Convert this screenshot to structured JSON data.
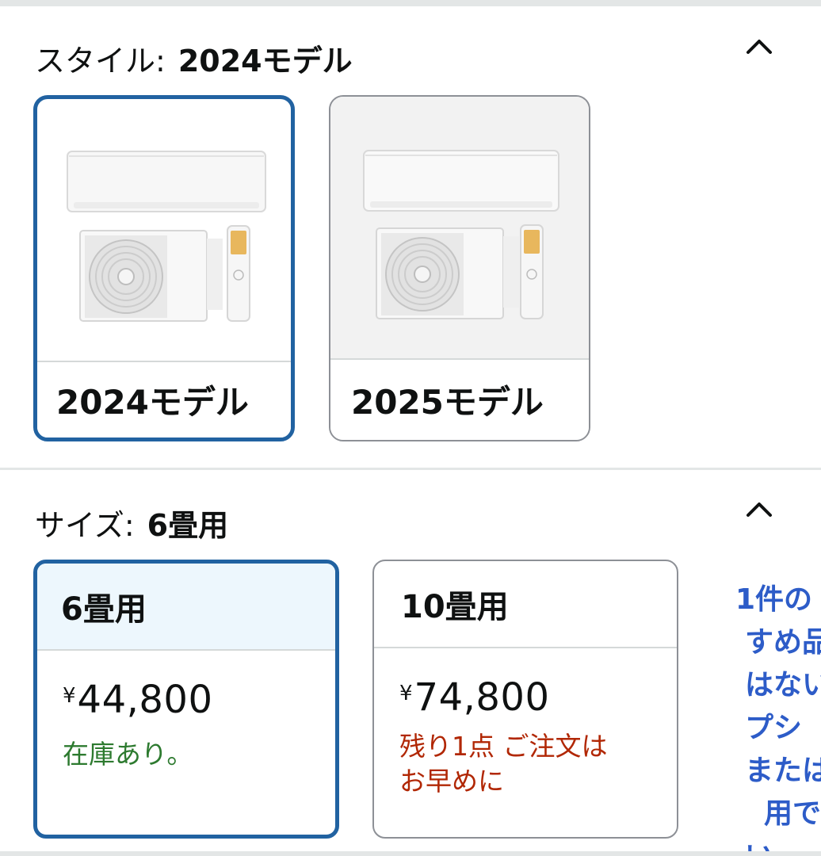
{
  "style_section": {
    "label": "スタイル:",
    "selected_value": "2024モデル",
    "options": [
      {
        "label": "2024モデル",
        "selected": true
      },
      {
        "label": "2025モデル",
        "selected": false
      }
    ],
    "collapse_icon": "chevron-up-icon"
  },
  "size_section": {
    "label": "サイズ:",
    "selected_value": "6畳用",
    "options": [
      {
        "label": "6畳用",
        "currency": "¥",
        "price": "44,800",
        "availability": "在庫あり。",
        "availability_status": "in-stock",
        "selected": true
      },
      {
        "label": "10畳用",
        "currency": "¥",
        "price": "74,800",
        "availability_line1": "残り1点 ご注文は",
        "availability_line2": "お早めに",
        "availability_status": "low-stock",
        "selected": false
      }
    ],
    "collapse_icon": "chevron-up-icon"
  },
  "side_note_lines": [
    "1件の",
    "すめ品",
    "はない",
    "プシ",
    "または",
    "用で",
    "い"
  ],
  "colors": {
    "selected_border": "#2162a1",
    "in_stock": "#2d7a2f",
    "low_stock": "#b12704",
    "link_blue": "#2d5cc8"
  }
}
